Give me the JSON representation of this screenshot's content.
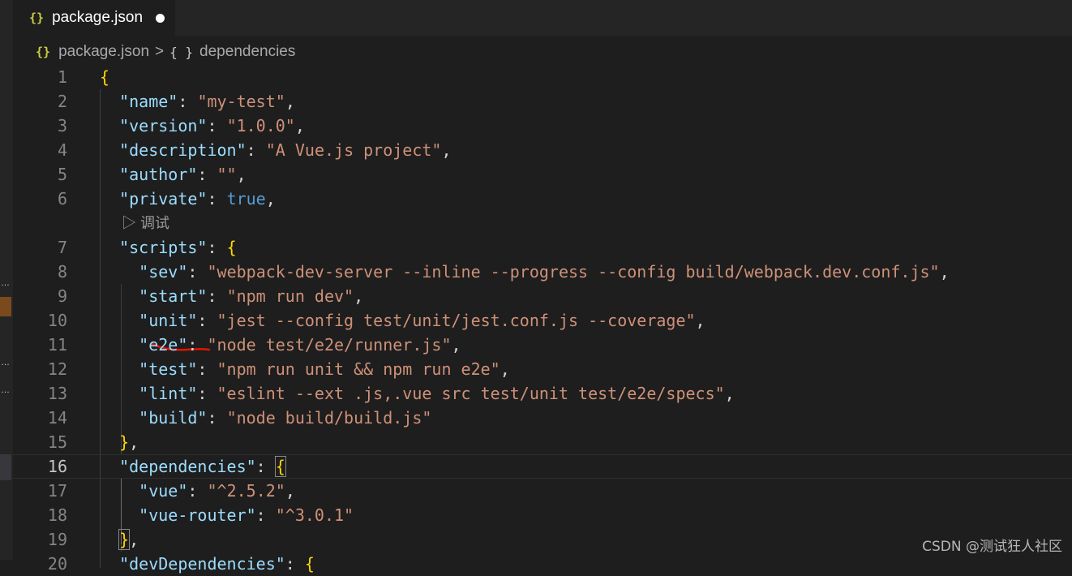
{
  "tab": {
    "title": "package.json",
    "icon": "json-braces-icon"
  },
  "breadcrumb": {
    "file": "package.json",
    "separator": ">",
    "symbol_icon": "{ }",
    "symbol": "dependencies"
  },
  "codelens": {
    "label": "调试"
  },
  "watermark": "CSDN @测试狂人社区",
  "colors": {
    "key": "#9cdcfe",
    "string": "#ce9178",
    "boolean": "#569cd6",
    "punct": "#d4d4d4",
    "bracket": "#ffd700",
    "line_number": "#858585",
    "squiggle": "#e51400"
  },
  "lines": [
    {
      "n": "1",
      "tokens": [
        {
          "t": "{",
          "c": "br"
        }
      ]
    },
    {
      "n": "2",
      "tokens": [
        {
          "t": "  "
        },
        {
          "t": "\"name\"",
          "c": "k"
        },
        {
          "t": ": "
        },
        {
          "t": "\"my-test\"",
          "c": "s"
        },
        {
          "t": ","
        }
      ]
    },
    {
      "n": "3",
      "tokens": [
        {
          "t": "  "
        },
        {
          "t": "\"version\"",
          "c": "k"
        },
        {
          "t": ": "
        },
        {
          "t": "\"1.0.0\"",
          "c": "s"
        },
        {
          "t": ","
        }
      ]
    },
    {
      "n": "4",
      "tokens": [
        {
          "t": "  "
        },
        {
          "t": "\"description\"",
          "c": "k"
        },
        {
          "t": ": "
        },
        {
          "t": "\"A Vue.js project\"",
          "c": "s"
        },
        {
          "t": ","
        }
      ]
    },
    {
      "n": "5",
      "tokens": [
        {
          "t": "  "
        },
        {
          "t": "\"author\"",
          "c": "k"
        },
        {
          "t": ": "
        },
        {
          "t": "\"\"",
          "c": "s"
        },
        {
          "t": ","
        }
      ]
    },
    {
      "n": "6",
      "tokens": [
        {
          "t": "  "
        },
        {
          "t": "\"private\"",
          "c": "k"
        },
        {
          "t": ": "
        },
        {
          "t": "true",
          "c": "b"
        },
        {
          "t": ","
        }
      ]
    },
    {
      "n": "7",
      "tokens": [
        {
          "t": "  "
        },
        {
          "t": "\"scripts\"",
          "c": "k"
        },
        {
          "t": ": "
        },
        {
          "t": "{",
          "c": "br"
        }
      ]
    },
    {
      "n": "8",
      "tokens": [
        {
          "t": "    "
        },
        {
          "t": "\"sev\"",
          "c": "k"
        },
        {
          "t": ": "
        },
        {
          "t": "\"webpack-dev-server --inline --progress --config build/webpack.dev.conf.js\"",
          "c": "s"
        },
        {
          "t": ","
        }
      ]
    },
    {
      "n": "9",
      "tokens": [
        {
          "t": "    "
        },
        {
          "t": "\"start\"",
          "c": "k"
        },
        {
          "t": ": "
        },
        {
          "t": "\"npm run dev\"",
          "c": "s"
        },
        {
          "t": ","
        }
      ]
    },
    {
      "n": "10",
      "tokens": [
        {
          "t": "    "
        },
        {
          "t": "\"unit\"",
          "c": "k"
        },
        {
          "t": ": "
        },
        {
          "t": "\"jest --config test/unit/jest.conf.js --coverage\"",
          "c": "s"
        },
        {
          "t": ","
        }
      ]
    },
    {
      "n": "11",
      "tokens": [
        {
          "t": "    "
        },
        {
          "t": "\"e2e\"",
          "c": "k"
        },
        {
          "t": ": "
        },
        {
          "t": "\"node test/e2e/runner.js\"",
          "c": "s"
        },
        {
          "t": ","
        }
      ]
    },
    {
      "n": "12",
      "tokens": [
        {
          "t": "    "
        },
        {
          "t": "\"test\"",
          "c": "k"
        },
        {
          "t": ": "
        },
        {
          "t": "\"npm run unit && npm run e2e\"",
          "c": "s"
        },
        {
          "t": ","
        }
      ]
    },
    {
      "n": "13",
      "tokens": [
        {
          "t": "    "
        },
        {
          "t": "\"lint\"",
          "c": "k"
        },
        {
          "t": ": "
        },
        {
          "t": "\"eslint --ext .js,.vue src test/unit test/e2e/specs\"",
          "c": "s"
        },
        {
          "t": ","
        }
      ]
    },
    {
      "n": "14",
      "tokens": [
        {
          "t": "    "
        },
        {
          "t": "\"build\"",
          "c": "k"
        },
        {
          "t": ": "
        },
        {
          "t": "\"node build/build.js\"",
          "c": "s"
        }
      ]
    },
    {
      "n": "15",
      "tokens": [
        {
          "t": "  "
        },
        {
          "t": "}",
          "c": "br"
        },
        {
          "t": ","
        }
      ]
    },
    {
      "n": "16",
      "current": true,
      "tokens": [
        {
          "t": "  "
        },
        {
          "t": "\"dependencies\"",
          "c": "k"
        },
        {
          "t": ": "
        },
        {
          "t": "{",
          "c": "br bm"
        }
      ]
    },
    {
      "n": "17",
      "tokens": [
        {
          "t": "    "
        },
        {
          "t": "\"vue\"",
          "c": "k"
        },
        {
          "t": ": "
        },
        {
          "t": "\"^2.5.2\"",
          "c": "s"
        },
        {
          "t": ","
        }
      ]
    },
    {
      "n": "18",
      "tokens": [
        {
          "t": "    "
        },
        {
          "t": "\"vue-router\"",
          "c": "k"
        },
        {
          "t": ": "
        },
        {
          "t": "\"^3.0.1\"",
          "c": "s"
        }
      ]
    },
    {
      "n": "19",
      "tokens": [
        {
          "t": "  "
        },
        {
          "t": "}",
          "c": "br bm"
        },
        {
          "t": ","
        }
      ]
    },
    {
      "n": "20",
      "tokens": [
        {
          "t": "  "
        },
        {
          "t": "\"devDependencies\"",
          "c": "k"
        },
        {
          "t": ": "
        },
        {
          "t": "{",
          "c": "br"
        }
      ]
    }
  ]
}
